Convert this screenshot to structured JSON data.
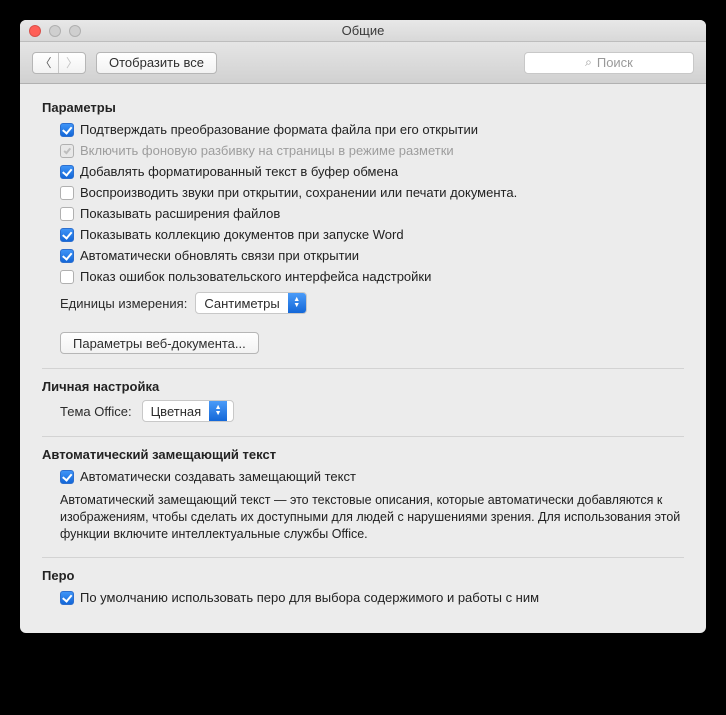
{
  "window": {
    "title": "Общие"
  },
  "toolbar": {
    "show_all": "Отобразить все",
    "search_placeholder": "Поиск"
  },
  "sections": {
    "params": {
      "heading": "Параметры",
      "items": [
        {
          "label": "Подтверждать преобразование формата файла при его открытии",
          "checked": true,
          "disabled": false
        },
        {
          "label": "Включить фоновую разбивку на страницы в режиме разметки",
          "checked": true,
          "disabled": true
        },
        {
          "label": "Добавлять форматированный текст в буфер обмена",
          "checked": true,
          "disabled": false
        },
        {
          "label": "Воспроизводить звуки при открытии, сохранении или печати документа.",
          "checked": false,
          "disabled": false
        },
        {
          "label": "Показывать расширения файлов",
          "checked": false,
          "disabled": false
        },
        {
          "label": "Показывать коллекцию документов при запуске Word",
          "checked": true,
          "disabled": false
        },
        {
          "label": "Автоматически обновлять связи при открытии",
          "checked": true,
          "disabled": false
        },
        {
          "label": "Показ ошибок пользовательского интерфейса надстройки",
          "checked": false,
          "disabled": false
        }
      ],
      "units_label": "Единицы измерения:",
      "units_value": "Сантиметры",
      "web_doc_button": "Параметры веб-документа..."
    },
    "personal": {
      "heading": "Личная настройка",
      "theme_label": "Тема Office:",
      "theme_value": "Цветная"
    },
    "alttext": {
      "heading": "Автоматический замещающий текст",
      "checkbox_label": "Автоматически создавать замещающий текст",
      "checkbox_checked": true,
      "description": "Автоматический замещающий текст — это текстовые описания, которые автоматически добавляются к изображениям, чтобы сделать их доступными для людей с нарушениями зрения. Для использования этой функции включите интеллектуальные службы Office."
    },
    "pen": {
      "heading": "Перо",
      "checkbox_label": "По умолчанию использовать перо для выбора содержимого и работы с ним",
      "checkbox_checked": true
    }
  }
}
